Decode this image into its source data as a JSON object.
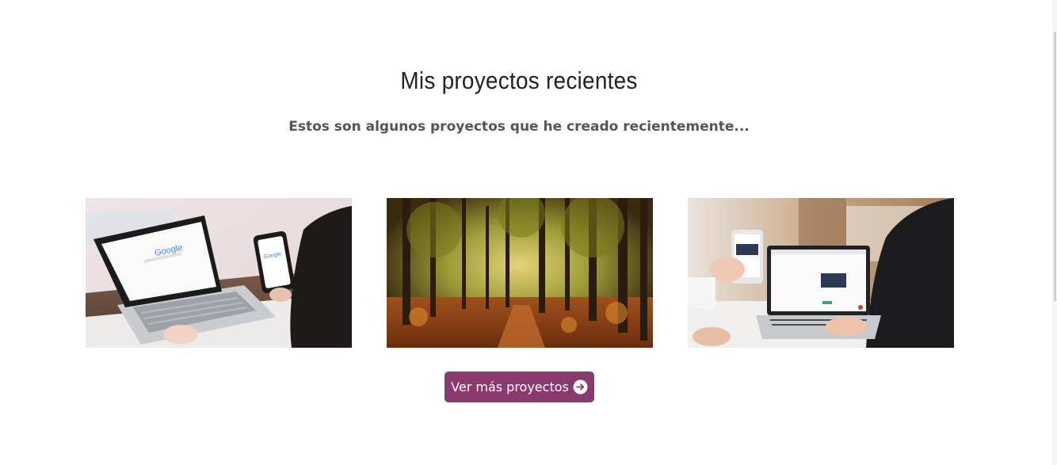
{
  "section": {
    "title": "Mis proyectos recientes",
    "subtitle": "Estos son algunos proyectos que he creado recientemente..."
  },
  "projects": [
    {
      "image": "laptop-and-phone-with-google-search",
      "screen_text": "Google"
    },
    {
      "image": "autumn-forest-path"
    },
    {
      "image": "hands-with-phone-and-laptop-web-app"
    }
  ],
  "cta": {
    "label": "Ver más proyectos",
    "icon": "arrow-right-circle-icon",
    "color": "#8a3a6f"
  }
}
